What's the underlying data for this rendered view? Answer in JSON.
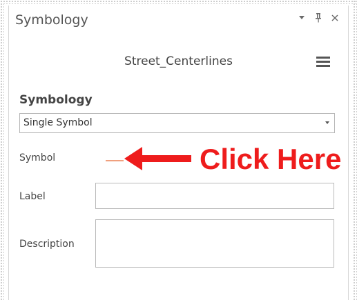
{
  "pane": {
    "title": "Symbology",
    "controls": {
      "dropdown_icon": "chevron-down",
      "pin_icon": "pin",
      "close_icon": "close"
    }
  },
  "layer": {
    "name": "Street_Centerlines",
    "menu_icon": "hamburger-menu"
  },
  "section": {
    "heading": "Symbology",
    "renderer_value": "Single Symbol"
  },
  "fields": {
    "symbol_label": "Symbol",
    "label_label": "Label",
    "label_value": "",
    "description_label": "Description",
    "description_value": ""
  },
  "annotation": {
    "text": "Click Here",
    "color": "#ee1c1c"
  },
  "colors": {
    "symbol_line": "#f0a07e"
  }
}
